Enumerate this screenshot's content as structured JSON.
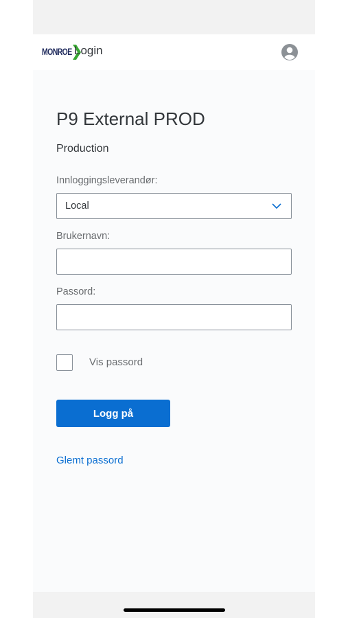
{
  "header": {
    "logo_text": "MONROE",
    "title": "Login",
    "avatar_icon": "user-avatar-icon"
  },
  "page": {
    "title": "P9 External PROD",
    "subtitle": "Production"
  },
  "form": {
    "provider_label": "Innloggingsleverandør:",
    "provider_value": "Local",
    "username_label": "Brukernavn:",
    "username_value": "",
    "password_label": "Passord:",
    "password_value": "",
    "show_password_label": "Vis passord",
    "show_password_checked": false,
    "login_button_label": "Logg på",
    "forgot_password_link": "Glemt passord"
  },
  "colors": {
    "accent": "#0a6ed1",
    "logo_green": "#3aa935",
    "logo_navy": "#1f2a5c"
  }
}
